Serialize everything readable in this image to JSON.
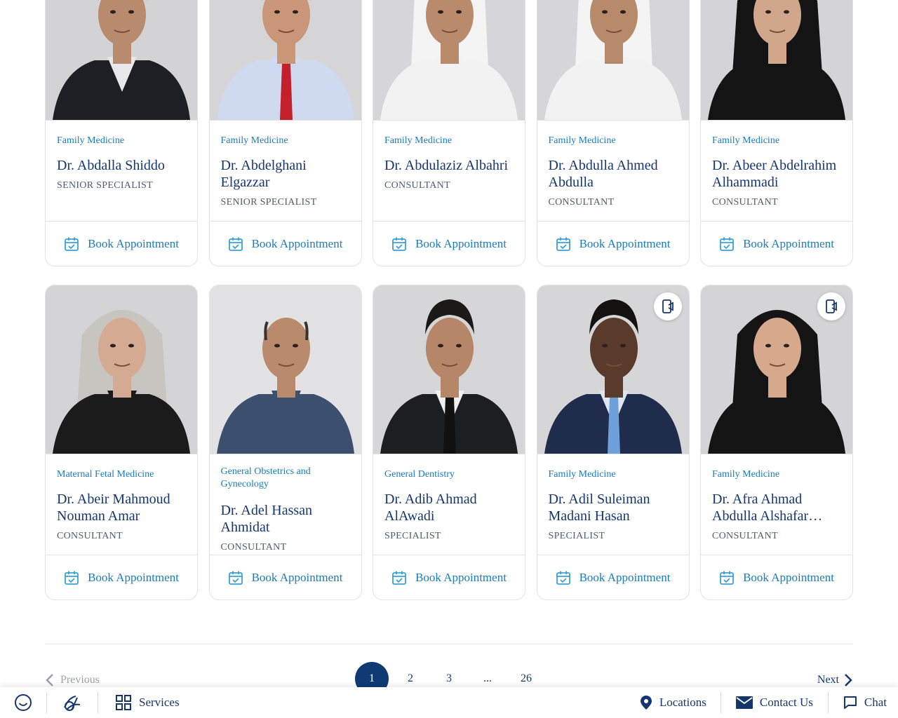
{
  "cards": [
    {
      "specialty": "Family Medicine",
      "name": "Dr. Abdalla Shiddo",
      "title": "SENIOR SPECIALIST",
      "book_label": "Book Appointment",
      "video": false,
      "photo": {
        "bg": "#d3d3d5",
        "skin": "#b88a6e",
        "hair": "#2a2522",
        "attire": "#1e1f24",
        "shirt": "#e8e8ea",
        "head": "hair"
      }
    },
    {
      "specialty": "Family Medicine",
      "name": "Dr. Abdelghani Elgazzar",
      "title": "SENIOR SPECIALIST",
      "book_label": "Book Appointment",
      "video": false,
      "photo": {
        "bg": "#d5d5d7",
        "skin": "#c99678",
        "hair": "#201c1a",
        "attire": "#cfd9f0",
        "shirt": "#cfd9f0",
        "tie": "#c4202c",
        "head": "hair"
      }
    },
    {
      "specialty": "Family Medicine",
      "name": "Dr. Abdulaziz Albahri",
      "title": "CONSULTANT",
      "book_label": "Book Appointment",
      "video": false,
      "photo": {
        "bg": "#d6d6d8",
        "skin": "#b98b6c",
        "hair": "#f4f4f4",
        "attire": "#f2f2f2",
        "shirt": "#f2f2f2",
        "head": "ghutra"
      }
    },
    {
      "specialty": "Family Medicine",
      "name": "Dr. Abdulla Ahmed Abdulla",
      "title": "CONSULTANT",
      "book_label": "Book Appointment",
      "video": false,
      "photo": {
        "bg": "#d6d6d8",
        "skin": "#b88a6c",
        "hair": "#f4f4f4",
        "attire": "#f2f2f2",
        "shirt": "#f2f2f2",
        "head": "ghutra"
      }
    },
    {
      "specialty": "Family Medicine",
      "name": "Dr. Abeer Abdelrahim Alhammadi",
      "title": "CONSULTANT",
      "book_label": "Book Appointment",
      "video": false,
      "photo": {
        "bg": "#d4d4d6",
        "skin": "#d2a68a",
        "hair": "#141414",
        "attire": "#141414",
        "shirt": "#141414",
        "head": "hijab-dark"
      }
    },
    {
      "specialty": "Maternal Fetal Medicine",
      "name": "Dr. Abeir Mahmoud Nouman Amar",
      "title": "CONSULTANT",
      "book_label": "Book Appointment",
      "video": false,
      "photo": {
        "bg": "#d4d4d6",
        "skin": "#d4ab92",
        "hair": "#c8c4c0",
        "attire": "#1b1b1b",
        "shirt": "#1b1b1b",
        "head": "hijab-light"
      }
    },
    {
      "specialty": "General Obstetrics and Gynecology",
      "name": "Dr. Adel Hassan Ahmidat",
      "title": "CONSULTANT",
      "book_label": "Book Appointment",
      "video": false,
      "photo": {
        "bg": "#e2e2e4",
        "skin": "#b98a6c",
        "hair": "#3a3330",
        "attire": "#3c4f6e",
        "shirt": "#3c4f6e",
        "head": "bald"
      }
    },
    {
      "specialty": "General Dentistry",
      "name": "Dr. Adib Ahmad AlAwadi",
      "title": "SPECIALIST",
      "book_label": "Book Appointment",
      "video": false,
      "photo": {
        "bg": "#d6d6d8",
        "skin": "#b58668",
        "hair": "#1c1a19",
        "attire": "#1d1e22",
        "shirt": "#f0f0f0",
        "tie": "#111111",
        "head": "hair"
      }
    },
    {
      "specialty": "Family Medicine",
      "name": "Dr. Adil Suleiman Madani Hasan",
      "title": "SPECIALIST",
      "book_label": "Book Appointment",
      "video": true,
      "photo": {
        "bg": "#d6d6d8",
        "skin": "#5a3a2a",
        "hair": "#141210",
        "attire": "#1f2c4c",
        "shirt": "#dfe6f2",
        "tie": "#6ea0dc",
        "head": "hair"
      }
    },
    {
      "specialty": "Family Medicine",
      "name": "Dr. Afra Ahmad Abdulla Alshafar…",
      "title": "CONSULTANT",
      "book_label": "Book Appointment",
      "video": true,
      "photo": {
        "bg": "#d4d4d6",
        "skin": "#d6a88c",
        "hair": "#141414",
        "attire": "#141414",
        "shirt": "#141414",
        "head": "hijab-dark"
      }
    }
  ],
  "pagination": {
    "previous_label": "Previous",
    "next_label": "Next",
    "pages": [
      "1",
      "2",
      "3",
      "...",
      "26"
    ],
    "current": "1"
  },
  "bottom_bar": {
    "services_label": "Services",
    "locations_label": "Locations",
    "contact_label": "Contact Us",
    "chat_label": "Chat"
  },
  "colors": {
    "primary": "#15366d",
    "accent": "#1a7bbf",
    "active_page": "#0f3a74"
  }
}
